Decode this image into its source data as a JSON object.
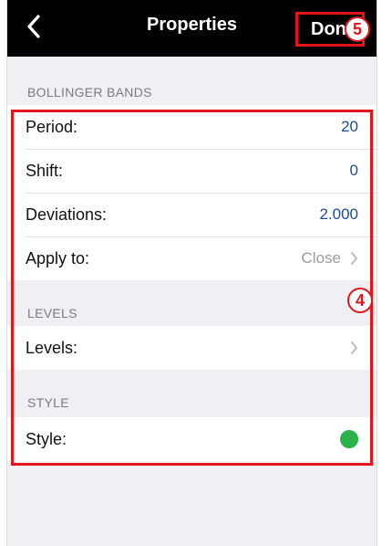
{
  "navbar": {
    "title": "Properties",
    "done_label": "Done",
    "back_icon": "chevron-left-icon"
  },
  "sections": {
    "bollinger": {
      "header": "BOLLINGER BANDS",
      "rows": [
        {
          "label": "Period:",
          "value": "20"
        },
        {
          "label": "Shift:",
          "value": "0"
        },
        {
          "label": "Deviations:",
          "value": "2.000"
        },
        {
          "label": "Apply to:",
          "value": "Close"
        }
      ]
    },
    "levels": {
      "header": "LEVELS",
      "row": {
        "label": "Levels:"
      }
    },
    "style": {
      "header": "STYLE",
      "row": {
        "label": "Style:",
        "color": "#2bb24c"
      }
    }
  },
  "annotations": {
    "badge_done": "5",
    "badge_group": "4",
    "highlight_color": "#e3141b"
  }
}
